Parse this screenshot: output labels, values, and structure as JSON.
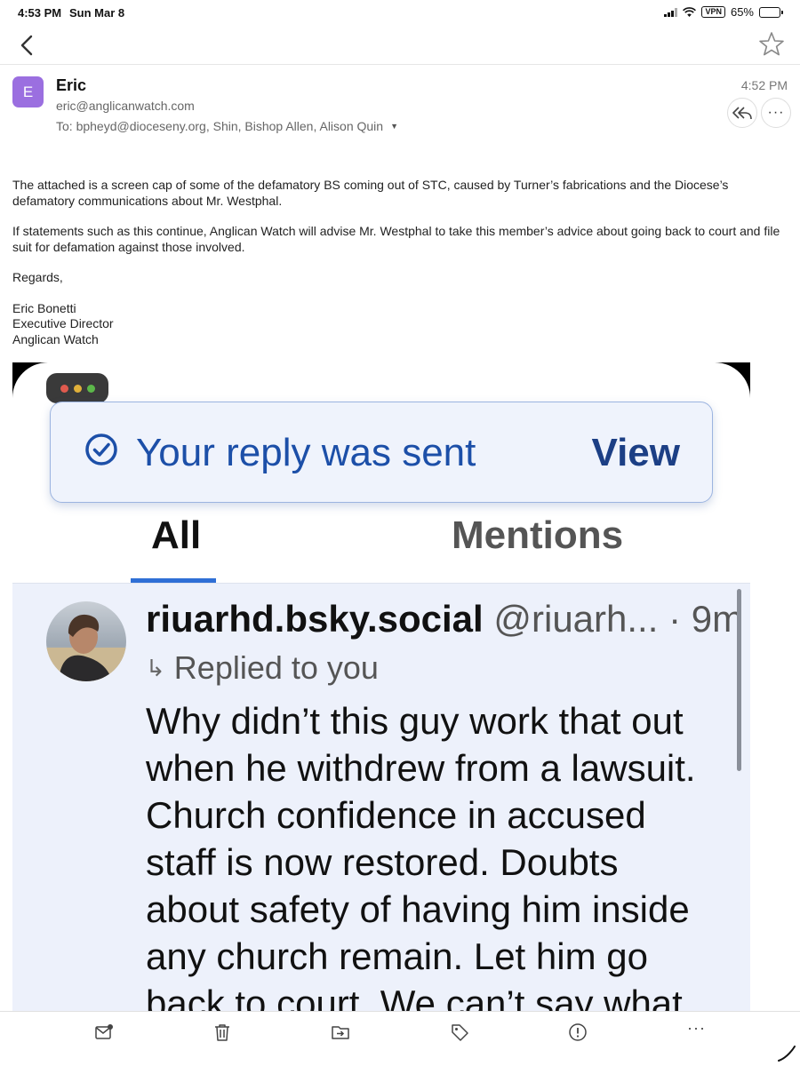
{
  "status_bar": {
    "time": "4:53 PM",
    "date": "Sun Mar 8",
    "vpn": "VPN",
    "battery": "65%",
    "battery_level": 0.65
  },
  "nav": {
    "back_icon": "chevron-left-icon",
    "star_icon": "star-icon"
  },
  "email": {
    "avatar_letter": "E",
    "avatar_color": "#9b6fe0",
    "sender_name": "Eric",
    "sender_email": "eric@anglicanwatch.com",
    "to_line": "To: bpheyd@dioceseny.org, Shin, Bishop Allen, Alison Quin",
    "time": "4:52 PM",
    "body": [
      "The attached is a screen cap of some of the defamatory BS coming out of STC, caused by Turner’s fabrications and the Diocese’s defamatory communications about Mr. Westphal.",
      "If statements such as this continue, Anglican Watch will advise Mr. Westphal to take this member’s advice about going back to court and file suit for defamation against those involved.",
      "Regards,"
    ],
    "signature": [
      "Eric Bonetti",
      "Executive Director",
      "Anglican Watch"
    ]
  },
  "attachment": {
    "toast_text": "Your reply was sent",
    "toast_action": "View",
    "tabs": [
      "All",
      "Mentions"
    ],
    "active_tab": "All",
    "notification": {
      "name": "riuarhd.bsky.social",
      "handle": " @riuarh... · 9m",
      "replied": "Replied to you",
      "lines": [
        "Why didn’t this guy work that out",
        "when he withdrew from a lawsuit.",
        "Church confidence in accused",
        "staff is now restored. Doubts",
        "about safety of having him inside",
        "any church remain. Let him go",
        "back to court. We can’t say what"
      ]
    }
  },
  "toolbar": {
    "icons": [
      "mail-unread-icon",
      "trash-icon",
      "move-to-folder-icon",
      "tag-icon",
      "report-spam-icon",
      "more-icon"
    ],
    "more": "···"
  },
  "colors": {
    "accent_blue": "#2f6fd6",
    "toast_text": "#1c4fa8",
    "notif_bg": "#edf1fb"
  }
}
